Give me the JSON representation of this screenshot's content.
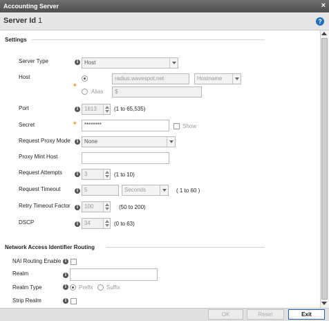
{
  "window": {
    "title": "Accounting Server",
    "close_glyph": "×"
  },
  "header": {
    "label": "Server Id",
    "value": "1",
    "help_glyph": "?"
  },
  "sections": {
    "settings": "Settings",
    "nai": "Network Access Identifier Routing"
  },
  "settings": {
    "server_type": {
      "label": "Server Type",
      "value": "Host"
    },
    "host": {
      "label": "Host",
      "host_value": "radius.wavespot.net",
      "host_type": "Hostname",
      "alias_label": "Alias",
      "alias_value": "$"
    },
    "port": {
      "label": "Port",
      "value": "1813",
      "hint": "(1 to 65,535)"
    },
    "secret": {
      "label": "Secret",
      "value": "********",
      "show_label": "Show"
    },
    "proxy_mode": {
      "label": "Request Proxy Mode",
      "value": "None"
    },
    "proxy_host": {
      "label": "Proxy Mint Host",
      "value": ""
    },
    "attempts": {
      "label": "Request Attempts",
      "value": "3",
      "hint": "(1 to 10)"
    },
    "timeout": {
      "label": "Request Timeout",
      "value": "5",
      "unit": "Seconds",
      "hint": "( 1 to 60 )"
    },
    "retry_factor": {
      "label": "Retry Timeout Factor",
      "value": "100",
      "hint": "(50 to 200)"
    },
    "dscp": {
      "label": "DSCP",
      "value": "34",
      "hint": "(0 to 63)"
    }
  },
  "nai": {
    "routing_enable": {
      "label": "NAI Routing Enable"
    },
    "realm": {
      "label": "Realm",
      "value": ""
    },
    "realm_type": {
      "label": "Realm Type",
      "prefix": "Prefix",
      "suffix": "Suffix"
    },
    "strip_realm": {
      "label": "Strip Realm"
    }
  },
  "footer": {
    "ok": "OK",
    "reset": "Reset",
    "exit": "Exit"
  },
  "icons": {
    "info": "i",
    "required": "*"
  },
  "colors": {
    "accent": "#1f6fc0",
    "required": "#f0a030",
    "titlebar": "#5a5a5a"
  }
}
